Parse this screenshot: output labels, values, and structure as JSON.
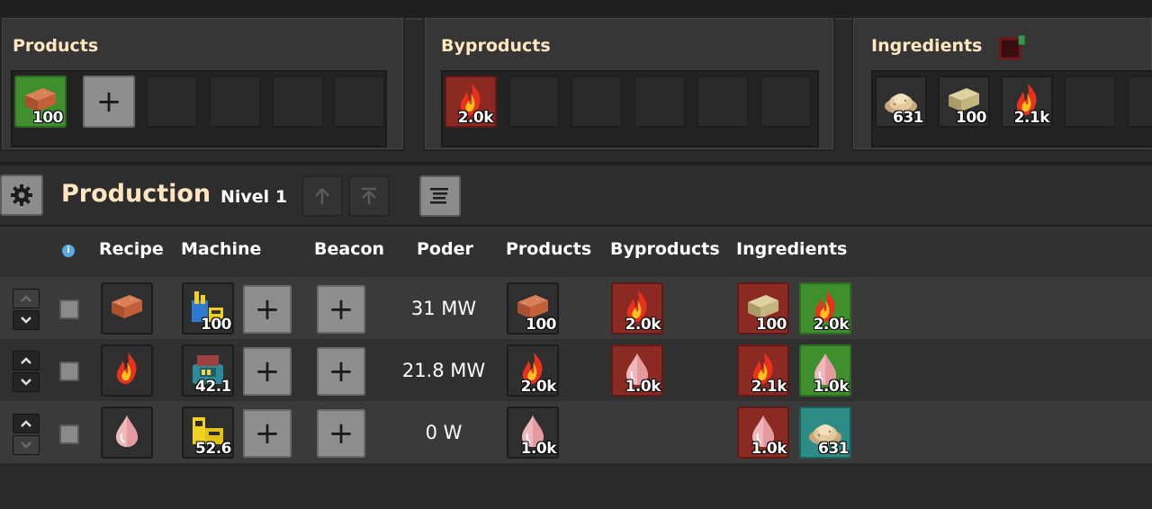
{
  "panels": {
    "products": {
      "title": "Products",
      "items": [
        {
          "icon": "brick-icon",
          "count": "100"
        }
      ]
    },
    "byproducts": {
      "title": "Byproducts",
      "items": [
        {
          "icon": "fire-icon",
          "count": "2.0k"
        }
      ]
    },
    "ingredients": {
      "title": "Ingredients",
      "items": [
        {
          "icon": "sawdust-icon",
          "count": "631"
        },
        {
          "icon": "stone-block-icon",
          "count": "100"
        },
        {
          "icon": "fire-icon",
          "count": "2.1k"
        }
      ]
    }
  },
  "production": {
    "title": "Production",
    "level": "Nivel 1"
  },
  "columns": {
    "recipe": "Recipe",
    "machine": "Machine",
    "beacon": "Beacon",
    "power": "Poder",
    "products": "Products",
    "byproducts": "Byproducts",
    "ingredients": "Ingredients"
  },
  "rows": [
    {
      "recipe_icon": "brick-icon",
      "machine_count": "100",
      "power": "31 MW",
      "product": {
        "icon": "brick-icon",
        "count": "100"
      },
      "byproduct": {
        "icon": "fire-icon",
        "count": "2.0k"
      },
      "ingredients": [
        {
          "icon": "stone-block-icon",
          "count": "100"
        },
        {
          "icon": "fire-icon",
          "count": "2.0k"
        }
      ]
    },
    {
      "recipe_icon": "fire-icon",
      "machine_count": "42.1",
      "power": "21.8 MW",
      "product": {
        "icon": "fire-icon",
        "count": "2.0k"
      },
      "byproduct": {
        "icon": "drop-icon",
        "count": "1.0k"
      },
      "ingredients": [
        {
          "icon": "fire-icon",
          "count": "2.1k"
        },
        {
          "icon": "drop-icon",
          "count": "1.0k"
        }
      ]
    },
    {
      "recipe_icon": "drop-icon",
      "machine_count": "52.6",
      "power": "0 W",
      "product": {
        "icon": "drop-icon",
        "count": "1.0k"
      },
      "byproduct": null,
      "ingredients": [
        {
          "icon": "drop-icon",
          "count": "1.0k"
        },
        {
          "icon": "sawdust-icon",
          "count": "631"
        }
      ]
    }
  ],
  "colors": {
    "title": "#ffe6c0",
    "green": "#3f8f2f",
    "red": "#8a2a22",
    "teal": "#2e8c86"
  }
}
